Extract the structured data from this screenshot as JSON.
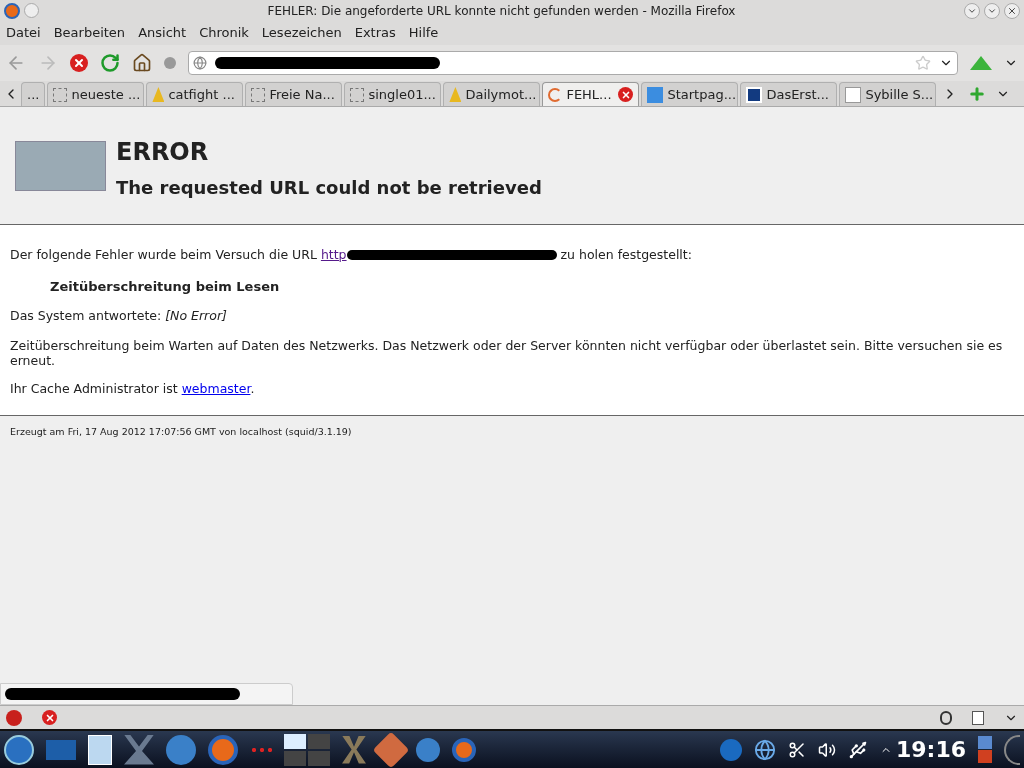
{
  "window": {
    "title": "FEHLER: Die angeforderte URL konnte nicht gefunden werden - Mozilla Firefox"
  },
  "menu": [
    "Datei",
    "Bearbeiten",
    "Ansicht",
    "Chronik",
    "Lesezeichen",
    "Extras",
    "Hilfe"
  ],
  "tabs": [
    {
      "label": "...",
      "kind": "overflow",
      "selected": false
    },
    {
      "label": "neueste ...",
      "kind": "blank",
      "selected": false
    },
    {
      "label": "catfight ...",
      "kind": "tower",
      "selected": false
    },
    {
      "label": "Freie Na...",
      "kind": "blank",
      "selected": false
    },
    {
      "label": "single01...",
      "kind": "blank",
      "selected": false
    },
    {
      "label": "Dailymot...",
      "kind": "tower",
      "selected": false
    },
    {
      "label": "FEHL...",
      "kind": "loading",
      "selected": true
    },
    {
      "label": "Startpag...",
      "kind": "sp",
      "selected": false
    },
    {
      "label": "DasErst...",
      "kind": "letterl",
      "selected": false
    },
    {
      "label": "Sybille S...",
      "kind": "letterw",
      "selected": false
    }
  ],
  "page": {
    "heading": "ERROR",
    "subheading": "The requested URL could not be retrieved",
    "intro_before": "Der folgende Fehler wurde beim Versuch die URL",
    "link": "http",
    "intro_after": "zu holen festgestellt:",
    "error": "Zeitüberschreitung beim Lesen",
    "reply_label": "Das System antwortete:",
    "reply_value": "[No Error]",
    "description": "Zeitüberschreitung beim Warten auf Daten des Netzwerks. Das Netzwerk oder der Server könnten nicht verfügbar oder überlastet sein. Bitte versuchen sie es erneut.",
    "admin_before": "Ihr Cache Administrator ist",
    "admin_link": "webmaster",
    "admin_after": ".",
    "footer": "Erzeugt am Fri, 17 Aug 2012 17:07:56 GMT von localhost (squid/3.1.19)"
  },
  "taskbar": {
    "clock": "19:16"
  }
}
